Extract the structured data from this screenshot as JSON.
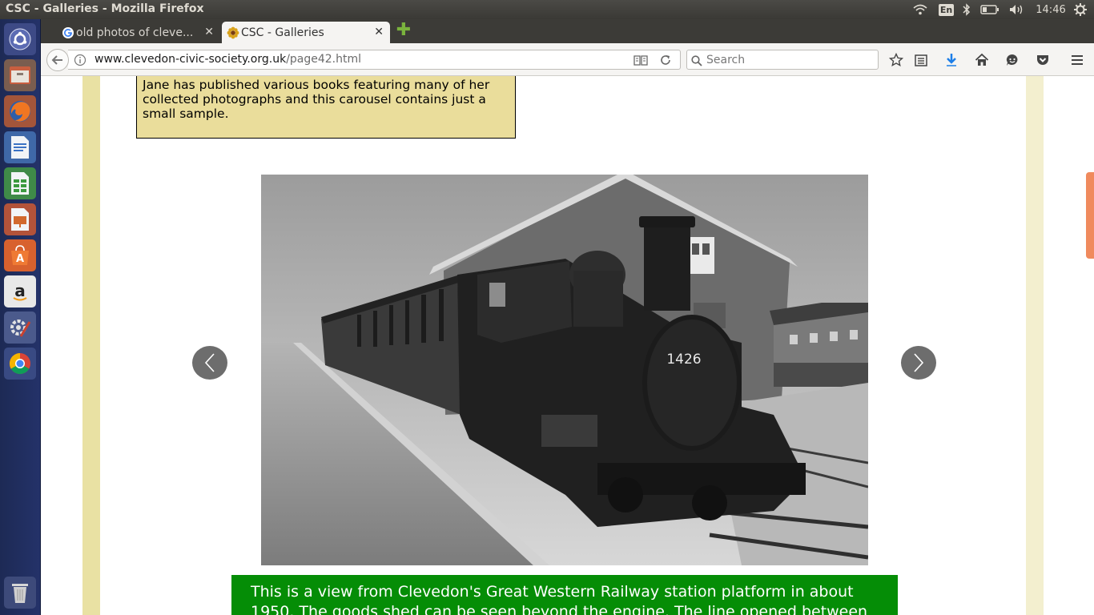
{
  "window": {
    "title": "CSC - Galleries - Mozilla Firefox"
  },
  "tray": {
    "keyboard": "En",
    "clock": "14:46"
  },
  "tabs": [
    {
      "label": "old photos of cleve...",
      "active": false
    },
    {
      "label": "CSC - Galleries",
      "active": true
    }
  ],
  "navbar": {
    "url_host": "www.clevedon-civic-society.org.uk",
    "url_path": "/page42.html",
    "search_placeholder": "Search"
  },
  "launcher": {
    "items": [
      "ubuntu-dash-icon",
      "files-icon",
      "firefox-icon",
      "writer-icon",
      "calc-icon",
      "impress-icon",
      "software-center-icon",
      "amazon-icon",
      "system-settings-icon",
      "chrome-icon",
      "trash-icon"
    ]
  },
  "page": {
    "info_text": "Jane has published various books featuring many of her collected photographs and this carousel contains just a small sample.",
    "photo_label": "1426",
    "caption": "This is a view from Clevedon's Great Western Railway station platform in about 1950. The goods shed can be seen beyond the engine. The line opened between"
  },
  "colors": {
    "panel": "#3c3b37",
    "launcher": "#243269",
    "page_band": "#e9e1a3",
    "info_box": "#eadd9b",
    "caption_bg": "#058d06",
    "scroll_thumb": "#f08a5d"
  }
}
